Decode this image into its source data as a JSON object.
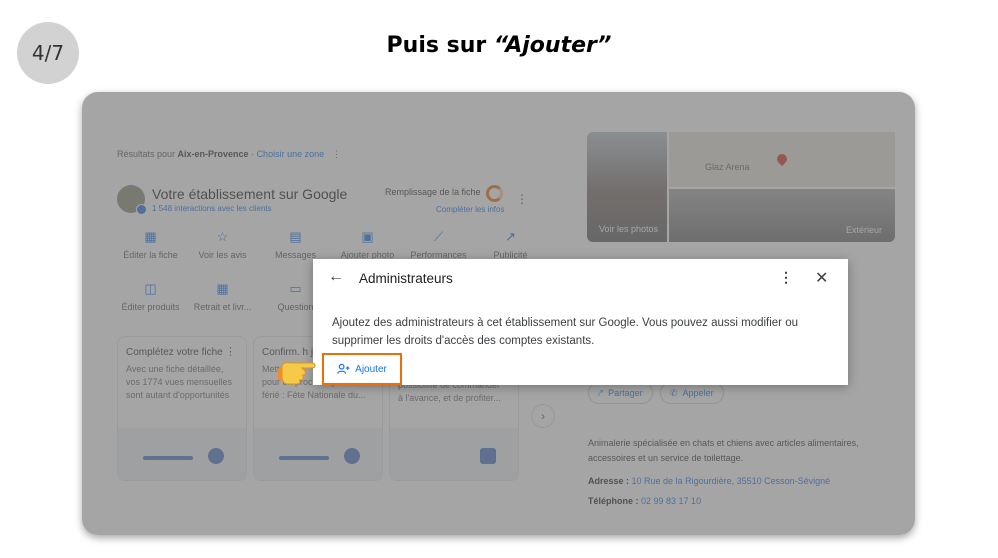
{
  "slide": {
    "step": "4/7",
    "title_prefix": "Puis sur ",
    "title_emphasis": "“Ajouter”"
  },
  "results_bar": {
    "prefix": "Résultats pour ",
    "location": "Aix-en-Provence",
    "separator": " · ",
    "zone_link": "Choisir une zone"
  },
  "business": {
    "title": "Votre établissement sur Google",
    "interactions": "1 548 interactions avec les clients",
    "fill_label": "Remplissage de la fiche",
    "fill_link": "Compléter les infos"
  },
  "actions_row1": [
    {
      "label": "Éditer la fiche",
      "icon": "storefront-icon"
    },
    {
      "label": "Voir les avis",
      "icon": "star-review-icon"
    },
    {
      "label": "Messages",
      "icon": "message-icon"
    },
    {
      "label": "Ajouter photo",
      "icon": "photo-icon"
    },
    {
      "label": "Performances",
      "icon": "trend-icon"
    },
    {
      "label": "Publicité",
      "icon": "ads-trend-icon"
    }
  ],
  "actions_row2": [
    {
      "label": "Éditer produits",
      "icon": "shopping-bag-icon"
    },
    {
      "label": "Retrait et livr...",
      "icon": "calendar-icon"
    },
    {
      "label": "Question",
      "icon": "question-icon"
    }
  ],
  "cards": [
    {
      "title": "Complétez votre fiche",
      "desc": [
        "Avec une fiche détaillée,",
        "vos 1774 vues mensuelles",
        "sont autant d'opportunités"
      ]
    },
    {
      "title": "Confirm. h jour",
      "desc": [
        "Mett",
        "pour un prochain jour",
        "férié : Fête Nationale du..."
      ]
    },
    {
      "title": "",
      "desc": [
        "possibilité de commander",
        "à l'avance, et de profiter..."
      ]
    }
  ],
  "photos": {
    "left_label": "Voir les photos",
    "right_label": "Extérieur",
    "map_label": "Glaz Arena"
  },
  "chips": [
    {
      "label": "Partager",
      "icon": "share-icon"
    },
    {
      "label": "Appeler",
      "icon": "phone-icon"
    }
  ],
  "info": {
    "description_line1": "Animalerie spécialisée en chats et chiens avec articles alimentaires,",
    "description_line2": "accessoires et un service de toilettage.",
    "address_label": "Adresse : ",
    "address_value": "10 Rue de la Rigourdière, 35510 Cesson-Sévigné",
    "phone_label": "Téléphone : ",
    "phone_value": "02 99 83 17 10"
  },
  "dialog": {
    "title": "Administrateurs",
    "description": "Ajoutez des administrateurs à cet établissement sur Google. Vous pouvez aussi modifier ou supprimer les droits d'accès des comptes existants.",
    "add_label": "Ajouter"
  },
  "colors": {
    "accent": "#1a73e8",
    "highlight": "#e8710a",
    "badge": "#d2d2d2"
  }
}
